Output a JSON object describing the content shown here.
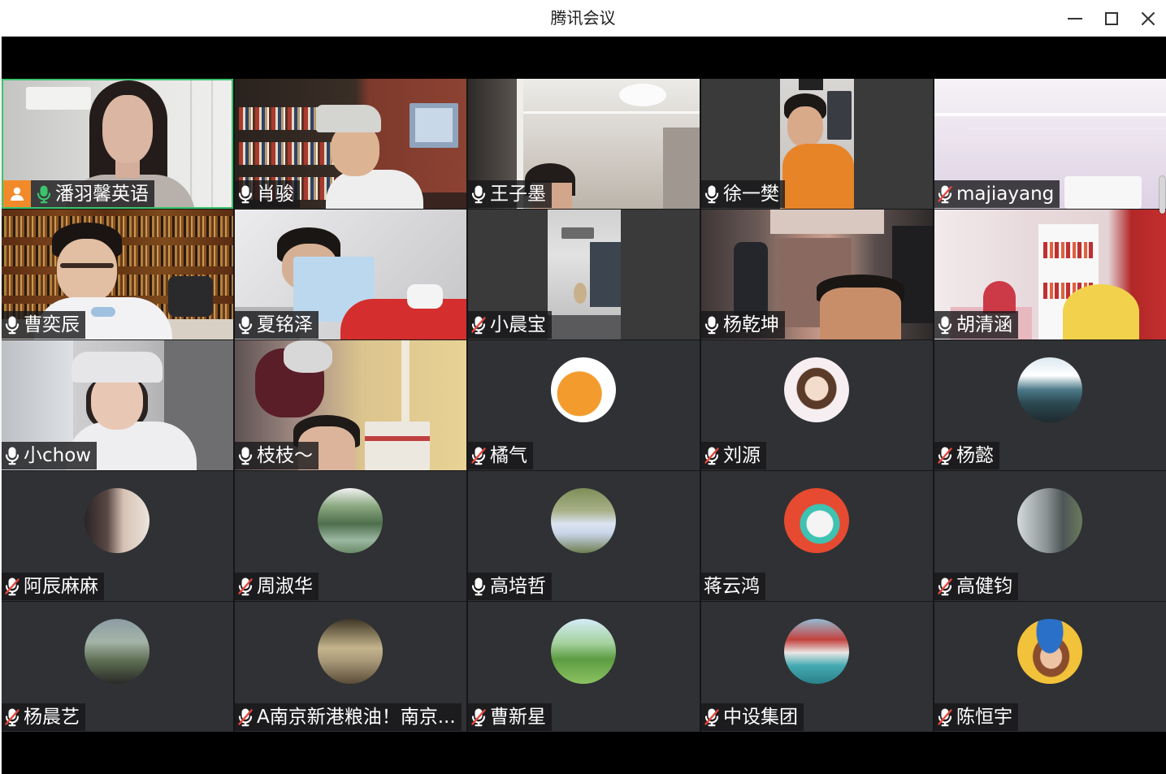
{
  "window": {
    "title": "腾讯会议",
    "minimize_icon": "minimize-icon",
    "maximize_icon": "maximize-icon",
    "close_icon": "close-icon"
  },
  "colors": {
    "active_speaker": "#3bc46b",
    "host_badge": "#f28a2a",
    "muted_slash": "#e8463c",
    "tile_bg": "#2f3134",
    "stage_bg": "#000000"
  },
  "participants": [
    {
      "name": "潘羽馨英语",
      "video": true,
      "host_badge_icon": "host-badge-icon",
      "mic_icon": "microphone-active-icon",
      "active_speaker": true
    },
    {
      "name": "肖骏",
      "video": true,
      "mic_icon": "microphone-icon"
    },
    {
      "name": "王子墨",
      "video": true,
      "mic_icon": "microphone-icon"
    },
    {
      "name": "徐一樊",
      "video": true,
      "mic_icon": "microphone-icon"
    },
    {
      "name": "majiayang",
      "video": true,
      "mic_icon": "microphone-muted-icon"
    },
    {
      "name": "曹奕辰",
      "video": true,
      "mic_icon": "microphone-icon"
    },
    {
      "name": "夏铭泽",
      "video": true,
      "mic_icon": "microphone-icon"
    },
    {
      "name": "小晨宝",
      "video": true,
      "mic_icon": "microphone-muted-icon"
    },
    {
      "name": "杨乾坤",
      "video": true,
      "mic_icon": "microphone-icon"
    },
    {
      "name": "胡清涵",
      "video": true,
      "mic_icon": "microphone-icon"
    },
    {
      "name": "小chow",
      "video": true,
      "mic_icon": "microphone-icon"
    },
    {
      "name": "枝枝～",
      "video": true,
      "mic_icon": "microphone-icon"
    },
    {
      "name": "橘气",
      "video": false,
      "mic_icon": "microphone-muted-icon"
    },
    {
      "name": "刘源",
      "video": false,
      "mic_icon": "microphone-muted-icon"
    },
    {
      "name": "杨懿",
      "video": false,
      "mic_icon": "microphone-muted-icon"
    },
    {
      "name": "阿辰麻麻",
      "video": false,
      "mic_icon": "microphone-muted-icon"
    },
    {
      "name": "周淑华",
      "video": false,
      "mic_icon": "microphone-muted-icon"
    },
    {
      "name": "高培哲",
      "video": false,
      "mic_icon": "microphone-icon"
    },
    {
      "name": "蒋云鸿",
      "video": false,
      "mic_icon": null
    },
    {
      "name": "高健钧",
      "video": false,
      "mic_icon": "microphone-muted-icon"
    },
    {
      "name": "杨晨艺",
      "video": false,
      "mic_icon": "microphone-muted-icon"
    },
    {
      "name": "A南京新港粮油！南京...",
      "video": false,
      "mic_icon": "microphone-muted-icon"
    },
    {
      "name": "曹新星",
      "video": false,
      "mic_icon": "microphone-muted-icon"
    },
    {
      "name": "中设集团",
      "video": false,
      "mic_icon": "microphone-muted-icon"
    },
    {
      "name": "陈恒宇",
      "video": false,
      "mic_icon": "microphone-muted-icon"
    }
  ]
}
